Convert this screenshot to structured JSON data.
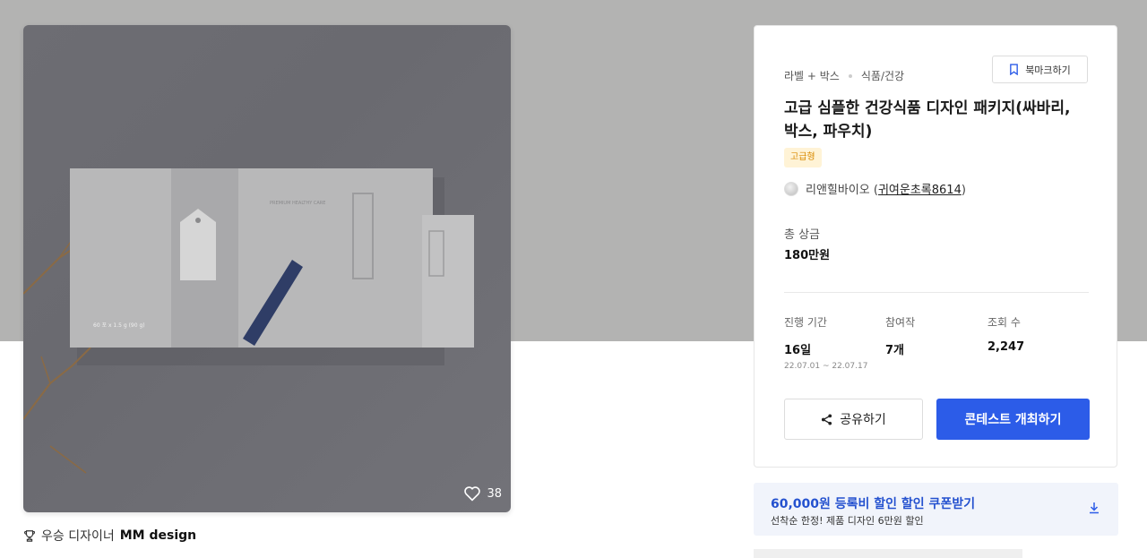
{
  "image": {
    "likes": "38",
    "box_text": "PREMIUM HEALTHY CARE",
    "box_sub": "60 포 x 1.5 g (90 g)"
  },
  "winner": {
    "prefix": "우승 디자이너",
    "name": "MM design"
  },
  "panel": {
    "category_1": "라벨 + 박스",
    "category_2": "식품/건강",
    "bookmark_label": "북마크하기",
    "title": "고급 심플한 건강식품 디자인 패키지(싸바리, 박스, 파우치)",
    "grade_badge": "고급형",
    "owner_name": "리앤힐바이오 (",
    "owner_id": "귀여운초록8614",
    "owner_suffix": ")",
    "prize_label": "총 상금",
    "prize_value": "180만원",
    "stats": [
      {
        "label": "진행 기간",
        "value": "16일",
        "sub": "22.07.01 ~ 22.07.17"
      },
      {
        "label": "참여작",
        "value": "7개",
        "sub": ""
      },
      {
        "label": "조회 수",
        "value": "2,247",
        "sub": ""
      }
    ],
    "share_label": "공유하기",
    "host_label": "콘테스트 개최하기"
  },
  "coupon": {
    "title": "60,000원 등록비 할인 할인 쿠폰받기",
    "subtitle": "선착순 한정! 제품 디자인 6만원 할인"
  },
  "colors": {
    "accent": "#2c5ce8",
    "coupon_text": "#2451cf",
    "badge_bg": "#fff3d6",
    "badge_text": "#d98a00"
  }
}
